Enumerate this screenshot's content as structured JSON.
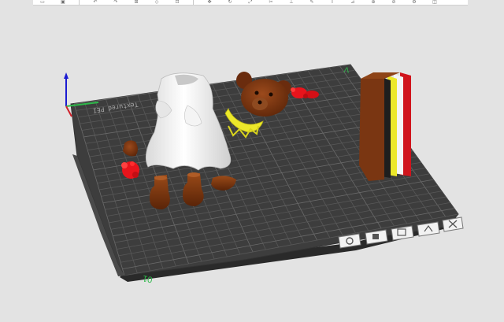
{
  "toolbar": {
    "buttons": [
      {
        "name": "open-icon"
      },
      {
        "name": "save-icon"
      },
      {
        "name": "undo-icon"
      },
      {
        "name": "redo-icon"
      },
      {
        "name": "add-plate-icon"
      },
      {
        "name": "orient-icon"
      },
      {
        "name": "arrange-icon"
      },
      {
        "name": "move-icon"
      },
      {
        "name": "rotate-icon"
      },
      {
        "name": "scale-icon"
      },
      {
        "name": "cut-icon"
      },
      {
        "name": "support-icon"
      },
      {
        "name": "paint-icon"
      },
      {
        "name": "text-icon"
      },
      {
        "name": "measure-icon"
      },
      {
        "name": "assemble-icon"
      },
      {
        "name": "split-icon"
      },
      {
        "name": "settings-icon"
      },
      {
        "name": "view-icon"
      }
    ]
  },
  "plate": {
    "number_label": "01",
    "back_text": "Textured PEI",
    "accent_color": "#2eb84a"
  },
  "plate_toolbar": {
    "buttons": [
      {
        "name": "slice-plate-icon"
      },
      {
        "name": "arrange-plate-icon"
      },
      {
        "name": "auto-orient-icon"
      },
      {
        "name": "lock-plate-icon"
      },
      {
        "name": "close-plate-icon"
      }
    ]
  },
  "colors": {
    "background": "#e3e3e3",
    "plate_fill": "#3d3d3d",
    "grid_line": "#5b5b5b",
    "model_white": "#f0f0f0",
    "model_brown": "#7a3612",
    "model_red": "#e8141c",
    "model_yellow": "#ece82a",
    "model_black": "#1e1e1e"
  }
}
